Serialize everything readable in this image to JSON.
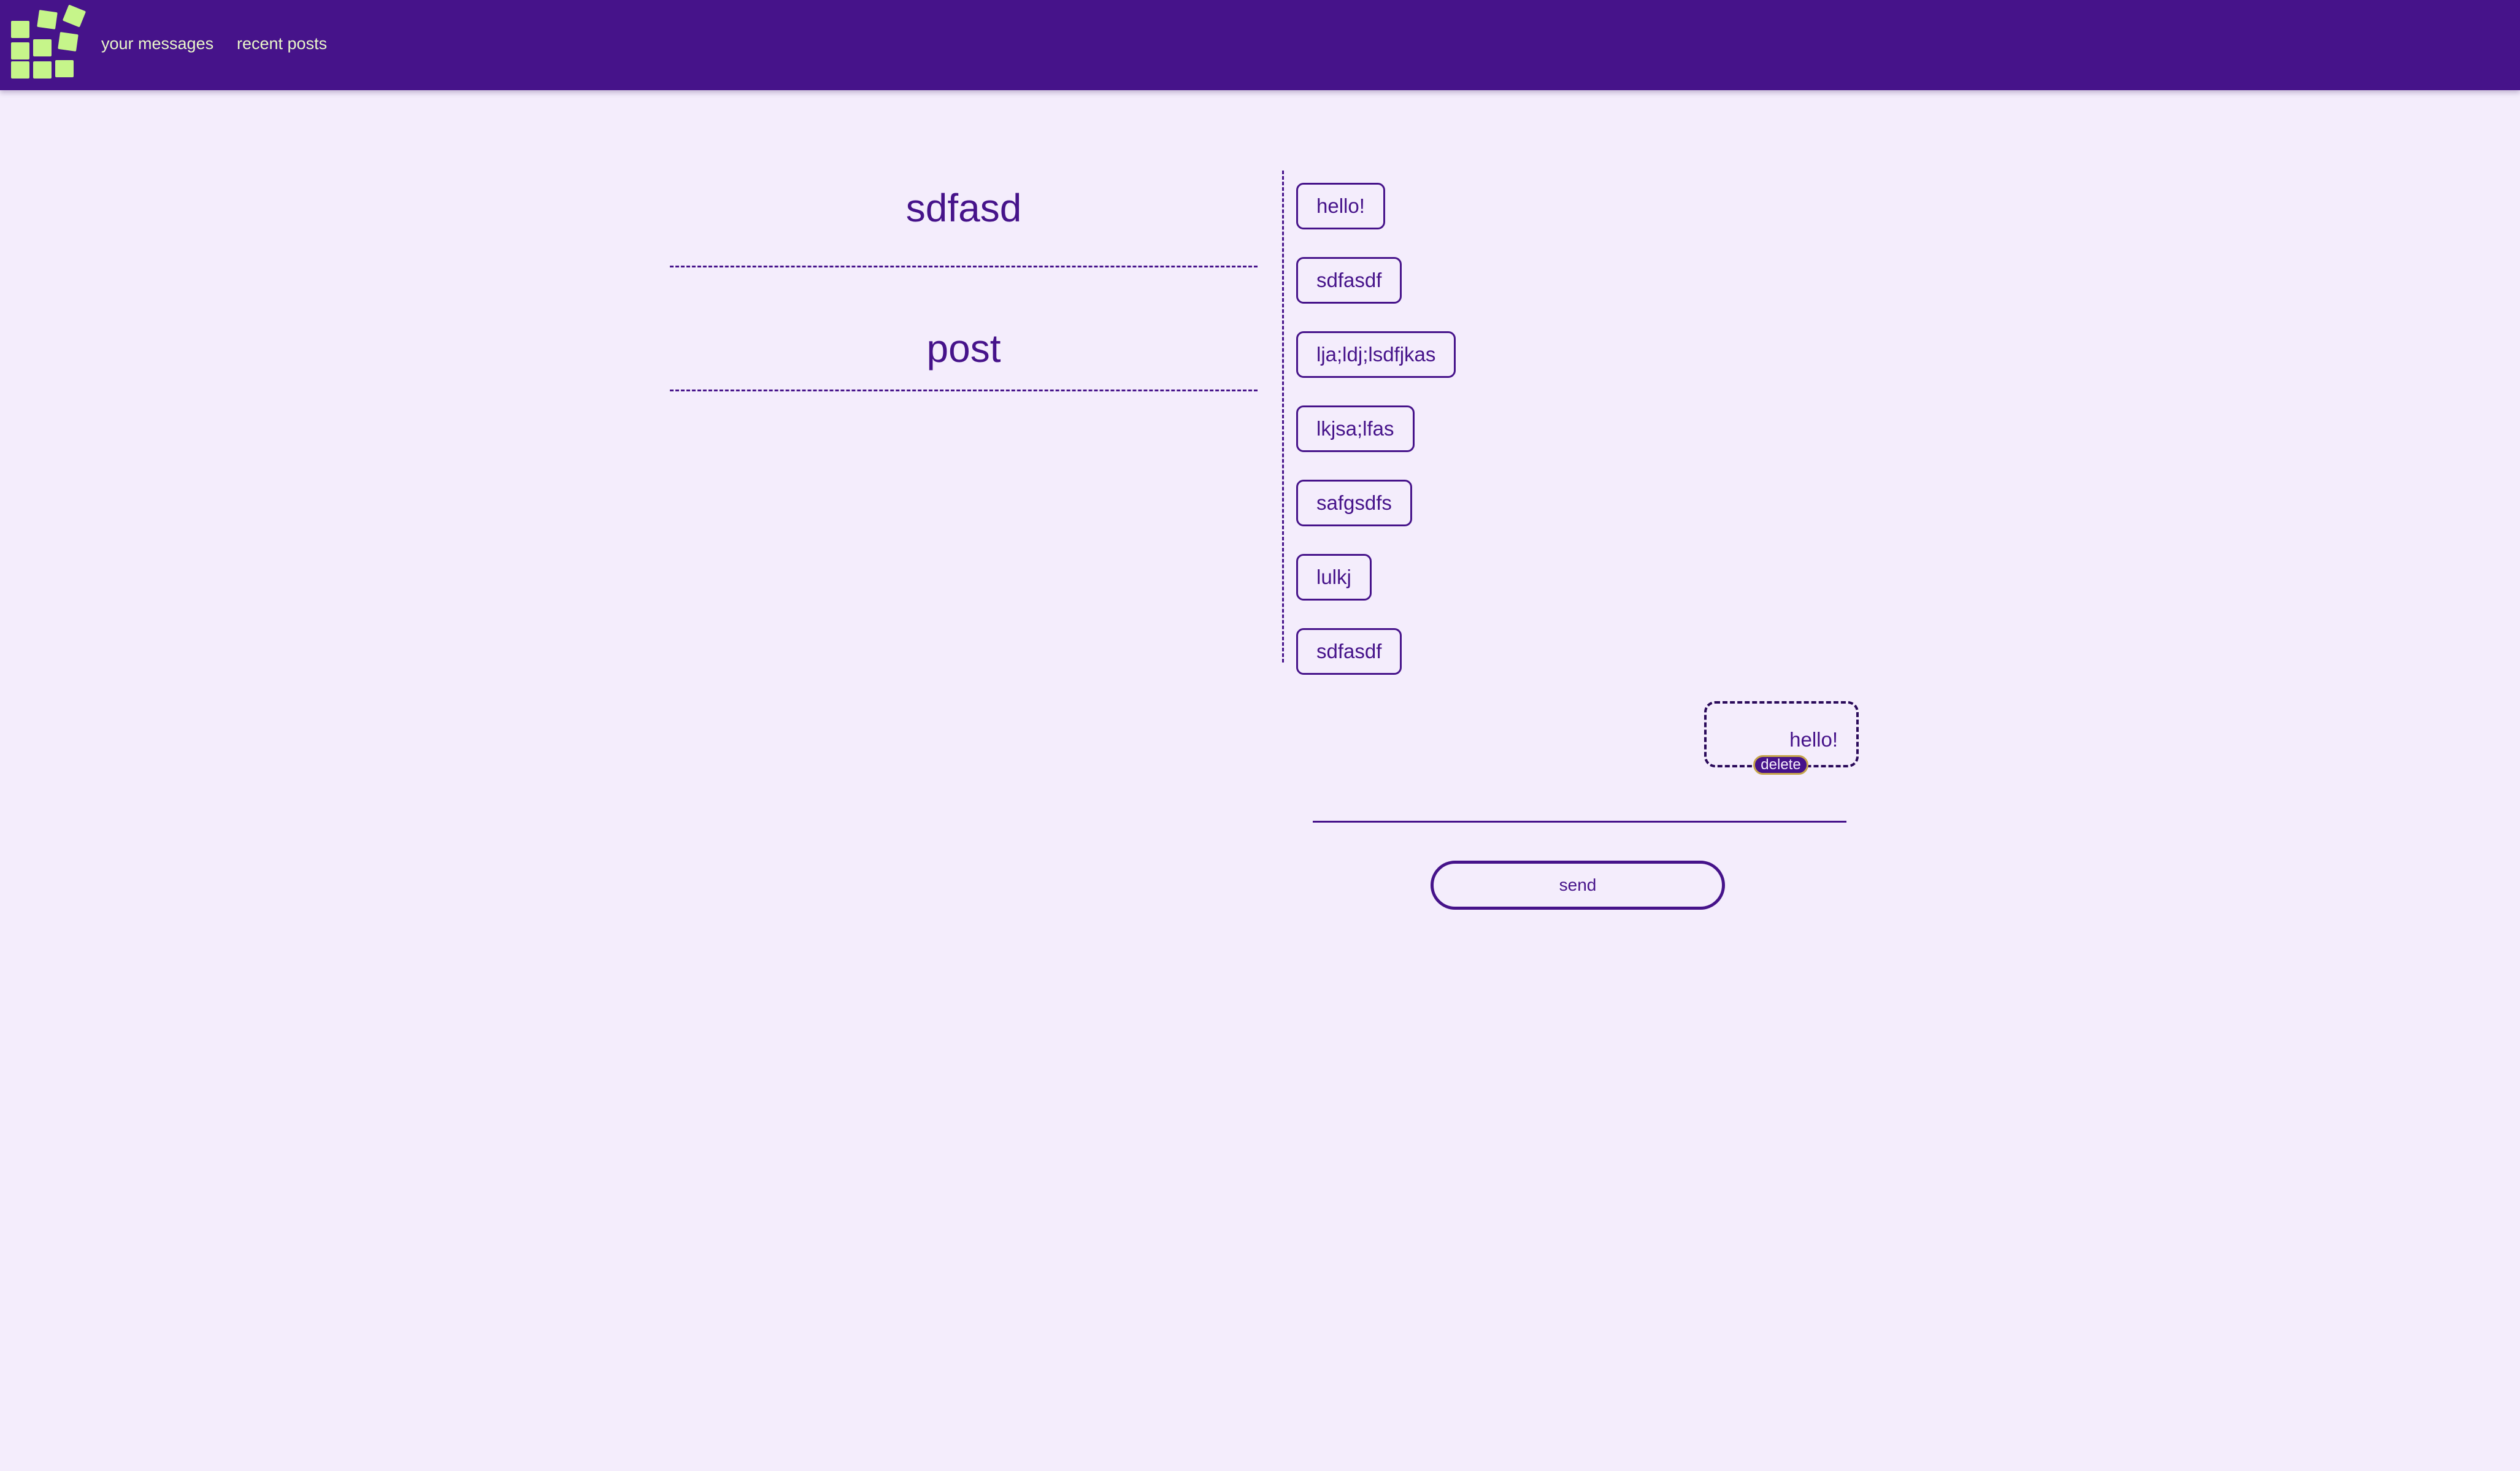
{
  "nav": {
    "logo_icon": "sticky-notes-grid-icon",
    "links": [
      "your messages",
      "recent posts"
    ]
  },
  "posts": [
    "sdfasd",
    "post"
  ],
  "messages": [
    "hello!",
    "sdfasdf",
    "lja;ldj;lsdfjkas",
    "lkjsa;lfas",
    "safgsdfs",
    "lulkj",
    "sdfasdf"
  ],
  "my_message": {
    "text": "hello!",
    "delete_label": "delete"
  },
  "composer": {
    "input_value": "",
    "send_label": "send"
  },
  "colors": {
    "header_bg": "#46138a",
    "page_bg": "#f4edfc",
    "accent": "#c6f58a",
    "text": "#46138a"
  }
}
